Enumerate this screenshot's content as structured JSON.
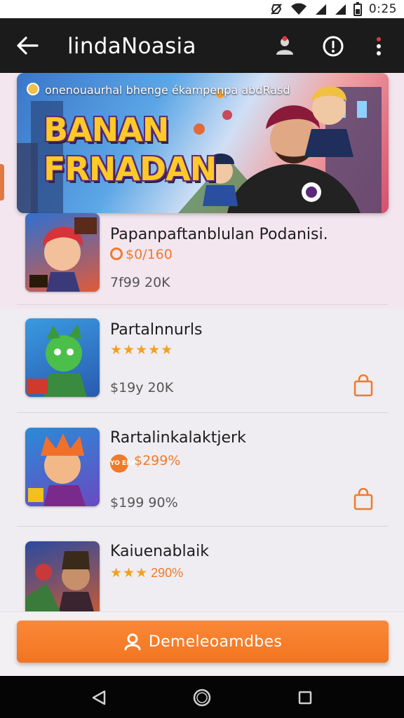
{
  "status_bar": {
    "time": "0:25"
  },
  "app_bar": {
    "title": "lindaNoasia",
    "icons": [
      "back-arrow-icon",
      "profile-icon",
      "info-icon",
      "more-vert-icon"
    ]
  },
  "banner": {
    "subtitle": "onenouaurhal bhenge ékampenpa abdRasd",
    "title_line1": "BANAN",
    "title_line2": "FRNADAN"
  },
  "items": [
    {
      "title": "Papanpaftanblulan Podanisi.",
      "price": "$0/160",
      "meta": "7f99 20K"
    },
    {
      "title": "Partalnnurls",
      "stars": "★★★★★",
      "rating_text": "",
      "meta": "$19y 20K"
    },
    {
      "title": "Rartalinkalaktjerk",
      "badge": "YO ERK",
      "price": "$299%",
      "meta": "$199 90%"
    },
    {
      "title": "Kaiuenablaik",
      "stars": "★★★",
      "rating_text": "290%",
      "meta": ""
    }
  ],
  "cta": {
    "label": "Demeleoamdbes"
  },
  "colors": {
    "accent": "#f27520",
    "app_bar": "#1b1b1b",
    "star": "#f2a022"
  }
}
